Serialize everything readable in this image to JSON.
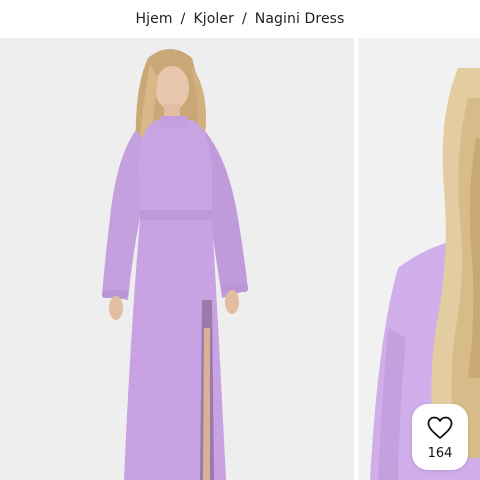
{
  "breadcrumb": {
    "items": [
      {
        "label": "Hjem"
      },
      {
        "label": "Kjoler"
      }
    ],
    "separator": "/",
    "current": "Nagini Dress"
  },
  "gallery": {
    "images": [
      {
        "alt": "Nagini Dress front"
      },
      {
        "alt": "Nagini Dress detail"
      }
    ],
    "dress_color": "#c9a2e3",
    "background_color": "#eeeeee"
  },
  "wishlist": {
    "icon": "heart-icon",
    "count": "164"
  }
}
